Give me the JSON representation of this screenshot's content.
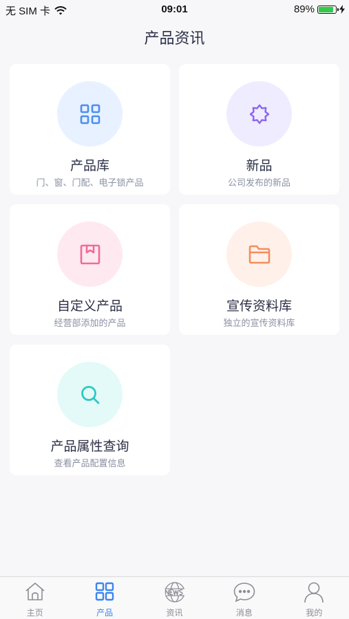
{
  "status_bar": {
    "carrier": "无 SIM 卡",
    "time": "09:01",
    "battery_percent": "89%",
    "battery_level": 0.89
  },
  "page": {
    "title": "产品资讯"
  },
  "cards": [
    {
      "title": "产品库",
      "subtitle": "门、窗、门配、电子锁产品",
      "icon": "grid-icon",
      "icon_color": "#4a8ef0",
      "bg": "#e8f1ff"
    },
    {
      "title": "新品",
      "subtitle": "公司发布的新品",
      "icon": "badge-icon",
      "icon_color": "#8b66f0",
      "bg": "#f0ecff"
    },
    {
      "title": "自定义产品",
      "subtitle": "经营部添加的产品",
      "icon": "box-icon",
      "icon_color": "#f06a9a",
      "bg": "#ffe9f0"
    },
    {
      "title": "宣传资料库",
      "subtitle": "独立的宣传资料库",
      "icon": "folder-icon",
      "icon_color": "#f38d5c",
      "bg": "#fff0ea"
    },
    {
      "title": "产品属性查询",
      "subtitle": "查看产品配置信息",
      "icon": "search-icon",
      "icon_color": "#2ec9c2",
      "bg": "#e3faf8"
    }
  ],
  "tabs": [
    {
      "label": "主页",
      "icon": "home-icon",
      "active": false
    },
    {
      "label": "产品",
      "icon": "grid-icon",
      "active": true
    },
    {
      "label": "资讯",
      "icon": "news-globe-icon",
      "active": false
    },
    {
      "label": "消息",
      "icon": "chat-bubble-icon",
      "active": false
    },
    {
      "label": "我的",
      "icon": "person-icon",
      "active": false
    }
  ],
  "colors": {
    "accent": "#3a86f0",
    "inactive": "#8c8c94",
    "background": "#f7f7f9"
  }
}
